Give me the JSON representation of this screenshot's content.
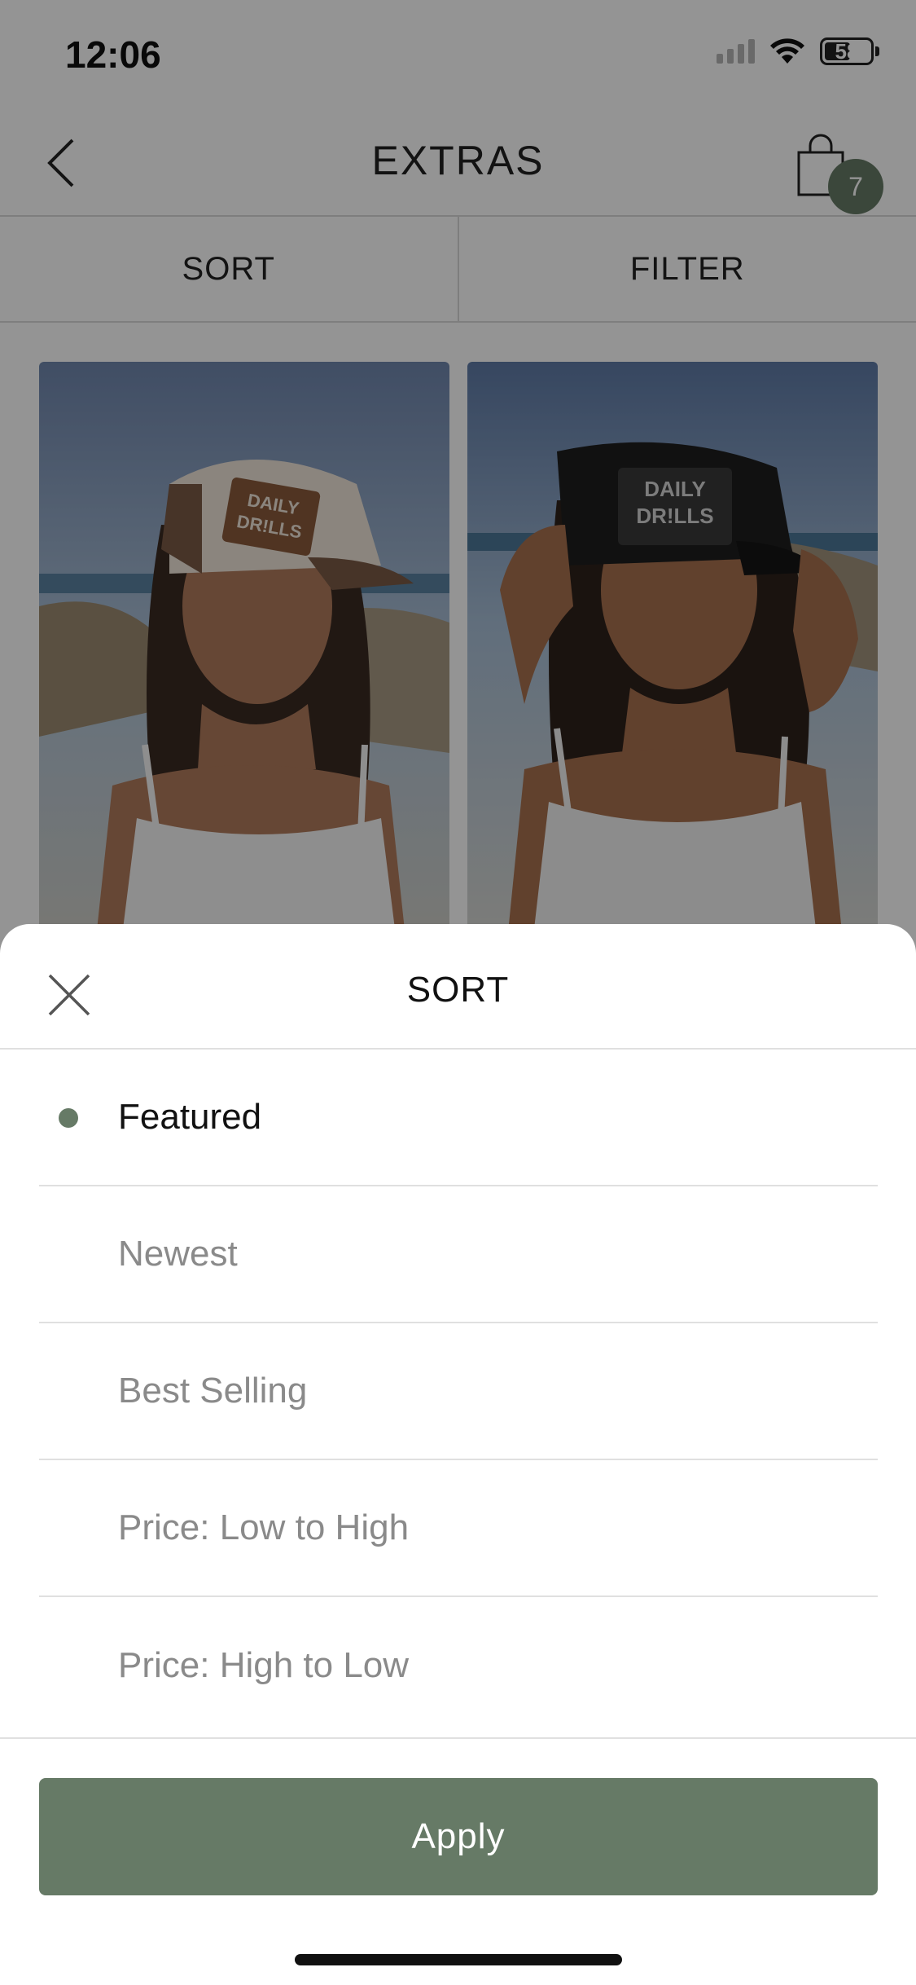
{
  "status_bar": {
    "time": "12:06",
    "battery": "58"
  },
  "nav": {
    "title": "EXTRAS",
    "cart_count": "7"
  },
  "toolbar": {
    "sort_label": "SORT",
    "filter_label": "FILTER"
  },
  "products": [
    {
      "logo_text_1": "DAILY",
      "logo_text_2": "DR!LLS"
    },
    {
      "logo_text_1": "DAILY",
      "logo_text_2": "DR!LLS"
    }
  ],
  "sort_sheet": {
    "title": "SORT",
    "options": [
      {
        "label": "Featured",
        "selected": true
      },
      {
        "label": "Newest",
        "selected": false
      },
      {
        "label": "Best Selling",
        "selected": false
      },
      {
        "label": "Price: Low to High",
        "selected": false
      },
      {
        "label": "Price: High to Low",
        "selected": false
      }
    ],
    "apply_label": "Apply"
  },
  "colors": {
    "accent": "#667a66",
    "overlay": "rgba(0,0,0,0.42)"
  }
}
